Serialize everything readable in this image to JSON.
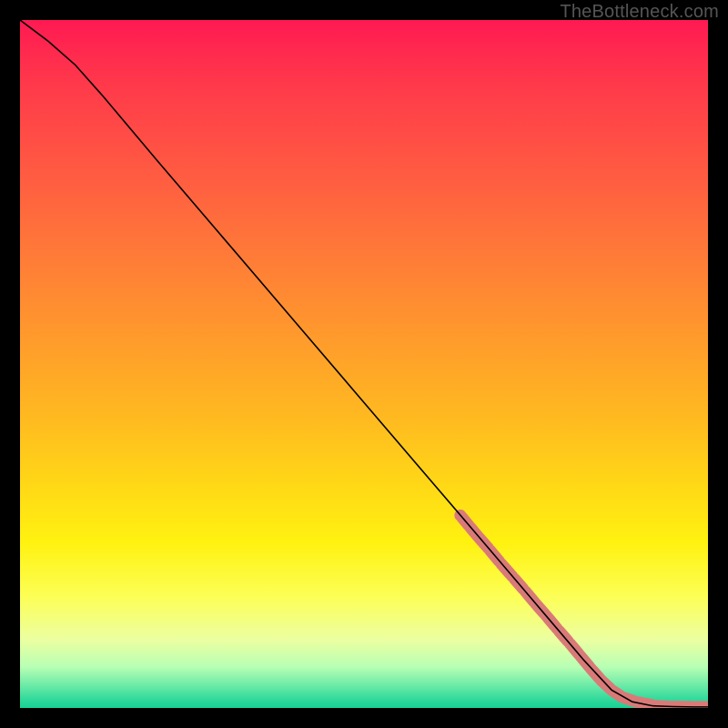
{
  "watermark": "TheBottleneck.com",
  "chart_data": {
    "type": "line",
    "title": "",
    "xlabel": "",
    "ylabel": "",
    "xlim": [
      0,
      100
    ],
    "ylim": [
      0,
      100
    ],
    "grid": false,
    "series": [
      {
        "name": "curve",
        "style": "solid-black",
        "x": [
          0,
          4,
          8,
          12,
          20,
          30,
          40,
          50,
          60,
          66,
          70,
          74,
          78,
          82,
          86,
          89,
          92,
          95,
          98,
          100
        ],
        "y": [
          100,
          97,
          93.5,
          89,
          79.5,
          67.8,
          56.1,
          44.4,
          32.7,
          25.7,
          21,
          16.3,
          11.6,
          6.9,
          2.6,
          0.9,
          0.3,
          0.2,
          0.15,
          0.15
        ]
      },
      {
        "name": "highlight-marks",
        "style": "salmon-thick-dash",
        "x": [
          64,
          65.5,
          66.5,
          68,
          70,
          71.5,
          73.5,
          75,
          76.5,
          78,
          80,
          81.5,
          83,
          84.5,
          86,
          87.5,
          89.5,
          92.5,
          94.5,
          98,
          100
        ],
        "y": [
          28.0,
          26.2,
          25.0,
          23.3,
          20.9,
          19.2,
          16.9,
          15.1,
          13.4,
          11.6,
          9.3,
          7.5,
          5.7,
          4.0,
          2.6,
          1.6,
          0.9,
          0.3,
          0.2,
          0.15,
          0.15
        ]
      }
    ]
  }
}
